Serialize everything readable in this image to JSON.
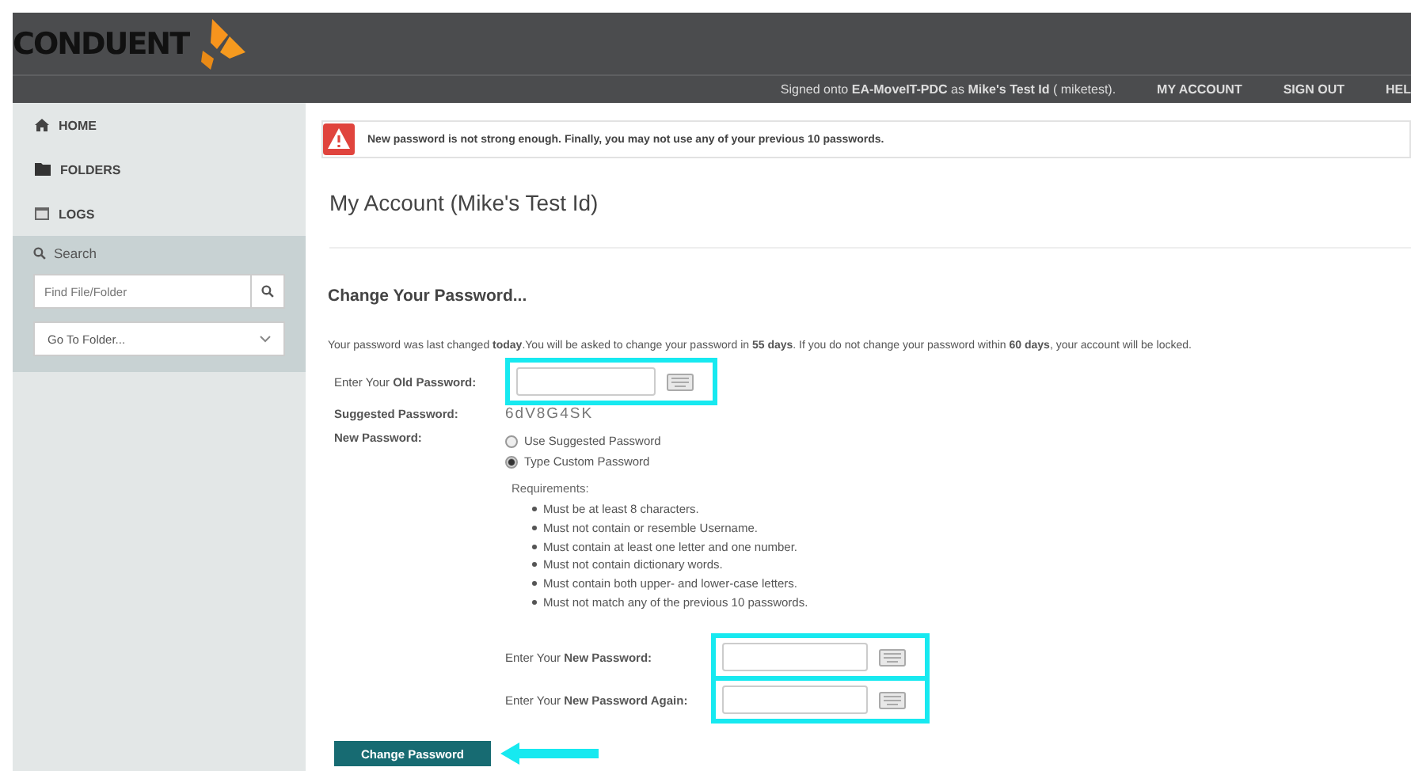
{
  "header": {
    "logo": "CONDUENT",
    "signed_in": "Signed onto **EA-MoveIT-PDC** as **Mike's Test Id** ( miketest).",
    "links": [
      {
        "label": "MY ACCOUNT"
      },
      {
        "label": "SIGN OUT"
      },
      {
        "label": "HEL"
      }
    ]
  },
  "sidebar": {
    "items": [
      {
        "label": "HOME",
        "kind": "home"
      },
      {
        "label": "FOLDERS",
        "kind": "folder"
      },
      {
        "label": "LOGS",
        "kind": "logs"
      }
    ],
    "search_title": "Search",
    "search_field": {
      "placeholder": "Find File/Folder"
    },
    "folder_select": {
      "value": "Go To Folder..."
    }
  },
  "alert": {
    "text": "New password is not strong enough. Finally, you may not use any of your previous 10 passwords."
  },
  "title": "My Account (Mike's Test Id)",
  "section_title": "Change Your Password...",
  "notice": "Your password was last changed **today**.You will be asked to change your password in **55 days**. If you do not change your password within **60 days**, your account will be locked.",
  "old_password": {
    "label": "Enter Your **Old Password:**",
    "highlighted": true
  },
  "suggested": {
    "label": "Suggested Password:",
    "value": "6dV8G4SK"
  },
  "new_password_label": "New Password:",
  "options": [
    {
      "label": "Use Suggested Password",
      "selected": false
    },
    {
      "label": "Type Custom Password",
      "selected": true
    }
  ],
  "requirements_title": "Requirements:",
  "requirements": [
    "Must be at least 8 characters.",
    "Must not contain or resemble Username.",
    "Must contain at least one letter and one number.",
    "Must not contain dictionary words.",
    "Must contain both upper- and lower-case letters.",
    "Must not match any of the previous 10 passwords."
  ],
  "new_fields": [
    {
      "label": "Enter Your **New Password:**",
      "highlighted": true
    },
    {
      "label": "Enter Your **New Password Again:**",
      "highlighted": true
    }
  ],
  "submit": {
    "label": "Change Password",
    "pointed": true
  }
}
